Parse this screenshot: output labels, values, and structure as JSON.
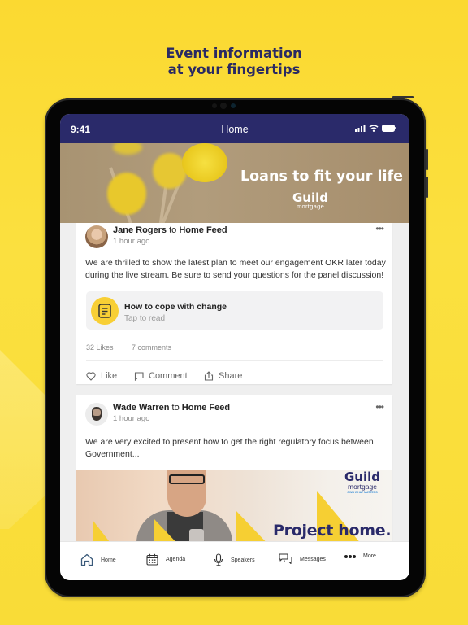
{
  "promo": {
    "headline_line1": "Event information",
    "headline_line2": "at your fingertips",
    "background_color": "#fbdd35",
    "headline_color": "#2a2a63"
  },
  "status_bar": {
    "time": "9:41",
    "title": "Home",
    "icons": [
      "signal-icon",
      "wifi-icon",
      "battery-icon"
    ],
    "bar_color": "#2a2a6a"
  },
  "banner": {
    "title": "Loans to fit your life",
    "logo_name": "Guild",
    "logo_sub": "mortgage"
  },
  "feed": {
    "posts": [
      {
        "author": "Jane Rogers",
        "connector": "to",
        "target": "Home Feed",
        "time": "1 hour ago",
        "text": "We are thrilled to show the latest plan to meet our engagement OKR later today during the live stream. Be sure to send your questions for the panel discussion!",
        "attachment": {
          "title": "How to cope with change",
          "subtitle": "Tap to read",
          "icon": "document-icon"
        },
        "likes": "32 Likes",
        "comments": "7 comments",
        "actions": {
          "like": "Like",
          "comment": "Comment",
          "share": "Share"
        }
      },
      {
        "author": "Wade Warren",
        "connector": "to",
        "target": "Home Feed",
        "time": "1 hour ago",
        "text": "We are very excited to present how to get the right regulatory focus between Government...",
        "image": {
          "logo_name": "Guild",
          "logo_sub": "mortgage",
          "logo_tagline": "OWN WHAT MATTERS",
          "headline": "Project home."
        }
      }
    ]
  },
  "tabbar": {
    "items": [
      {
        "label": "Home",
        "icon": "home-icon",
        "active": true
      },
      {
        "label": "Agenda",
        "icon": "calendar-icon",
        "active": false
      },
      {
        "label": "Speakers",
        "icon": "microphone-icon",
        "active": false
      },
      {
        "label": "Messages",
        "icon": "chat-bubbles-icon",
        "active": false
      },
      {
        "label": "More",
        "icon": "more-dots-icon",
        "active": false
      }
    ]
  }
}
